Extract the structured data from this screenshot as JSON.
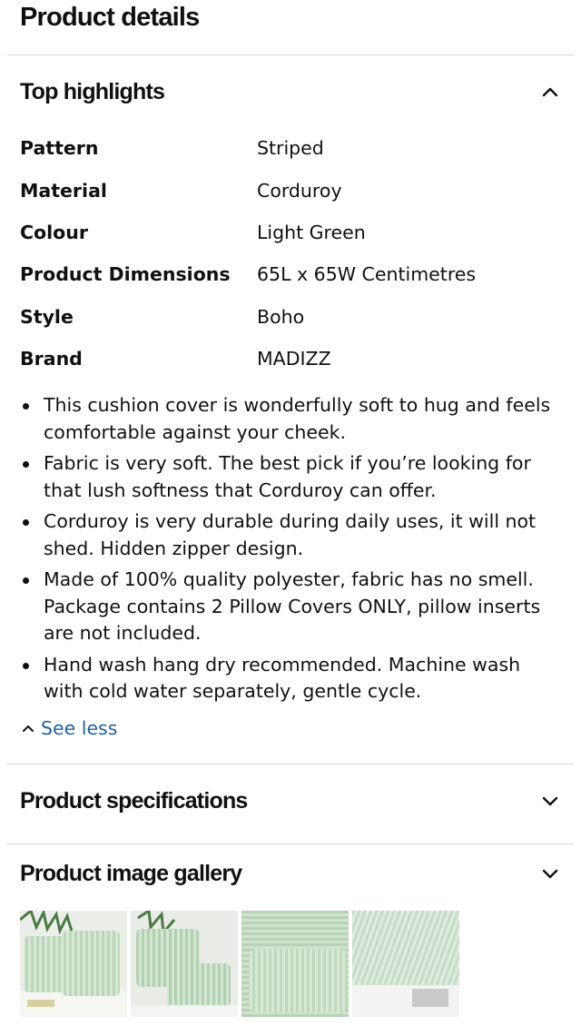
{
  "page_title": "Product details",
  "top_highlights": {
    "title": "Top highlights",
    "attributes": [
      {
        "key": "Pattern",
        "value": "Striped"
      },
      {
        "key": "Material",
        "value": "Corduroy"
      },
      {
        "key": "Colour",
        "value": "Light Green"
      },
      {
        "key": "Product Dimensions",
        "value": "65L x 65W Centimetres"
      },
      {
        "key": "Style",
        "value": "Boho"
      },
      {
        "key": "Brand",
        "value": "MADIZZ"
      }
    ],
    "bullets": [
      "This cushion cover is wonderfully soft to hug and feels comfortable against your cheek.",
      "Fabric is very soft. The best pick if you’re looking for that lush softness that Corduroy can offer.",
      "Corduroy is very durable during daily uses, it will not shed. Hidden zipper design.",
      "Made of 100% quality polyester, fabric has no smell. Package contains 2 Pillow Covers ONLY, pillow inserts are not included.",
      "Hand wash hang dry recommended. Machine wash with cold water separately, gentle cycle."
    ],
    "see_less_label": "See less"
  },
  "product_specifications": {
    "title": "Product specifications"
  },
  "product_image_gallery": {
    "title": "Product image gallery"
  },
  "icons": {
    "collapse": "chevron-up-icon",
    "expand": "chevron-down-icon",
    "see_less": "chevron-up-icon"
  },
  "colors": {
    "link": "#2162a1",
    "divider": "#d5d9d9",
    "text": "#0f1111",
    "pillow": "#cfe3cf"
  }
}
